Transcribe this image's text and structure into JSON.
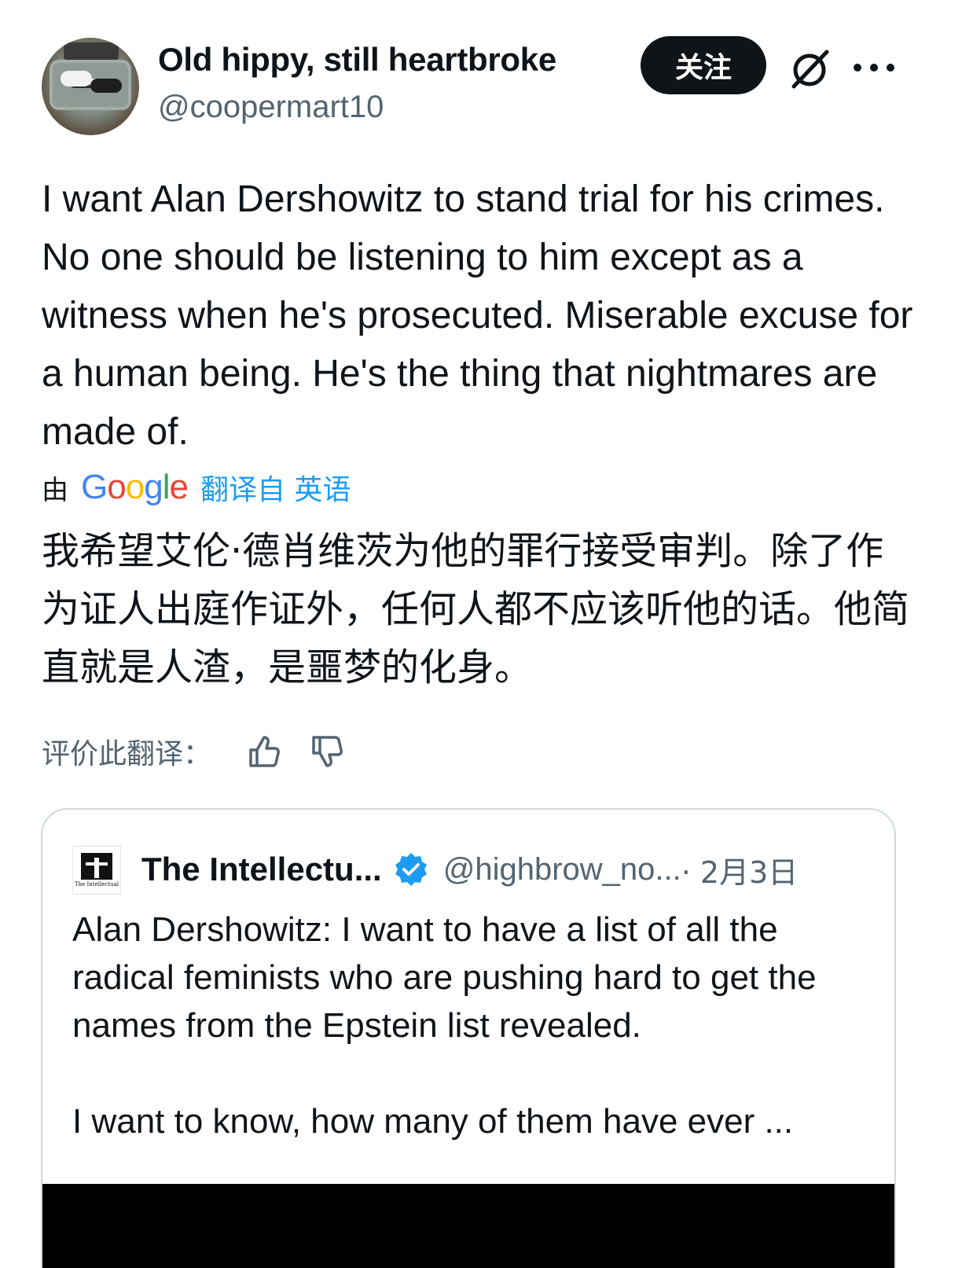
{
  "author": {
    "display_name": "Old hippy, still heartbroke",
    "handle": "@coopermart10"
  },
  "header": {
    "follow_label": "关注",
    "grok_icon": "slashed-circle-icon",
    "more_icon": "more-dots-icon"
  },
  "tweet": {
    "text": "I want Alan Dershowitz to stand trial for his crimes. No one should be listening to him except as a witness when he's prosecuted. Miserable excuse for a human being. He's the thing that nightmares are made of."
  },
  "translation": {
    "by_label": "由",
    "provider": "Google",
    "from_label": "翻译自 英语",
    "text": "我希望艾伦·德肖维茨为他的罪行接受审判。除了作为证人出庭作证外，任何人都不应该听他的话。他简直就是人渣，是噩梦的化身。",
    "rate_label": "评价此翻译："
  },
  "quoted_tweet": {
    "avatar_text": "The Intellectual",
    "name": "The Intellectu...",
    "handle": "@highbrow_no...",
    "date": " · 2月3日",
    "paragraphs": [
      "Alan Dershowitz: I want to have a list of all the radical feminists who are pushing hard to get the names from the Epstein list revealed.",
      "I want to know, how many of them have ever ..."
    ]
  },
  "colors": {
    "text_primary": "#0f1419",
    "text_secondary": "#536471",
    "link_blue": "#1d9bf0",
    "border": "#cfd9de",
    "follow_bg": "#0f1419"
  }
}
